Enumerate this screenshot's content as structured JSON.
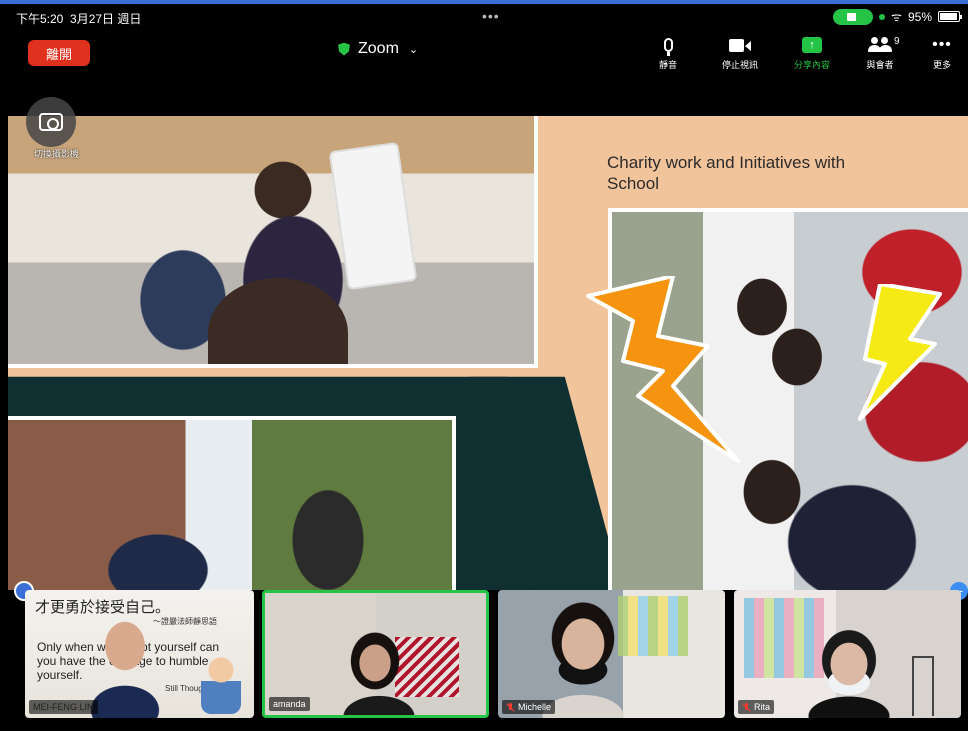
{
  "status_bar": {
    "time": "下午5:20",
    "date": "3月27日 週日",
    "battery": "95%",
    "battery_level": 0.95
  },
  "toolbar": {
    "leave_label": "離開",
    "meeting_title": "Zoom",
    "mute_label": "靜音",
    "stop_video_label": "停止視訊",
    "share_label": "分享內容",
    "participants_label": "與會者",
    "participants_count": "9",
    "more_label": "更多"
  },
  "camera_flip": {
    "label": "切換攝影機"
  },
  "shared_slide": {
    "title": "Charity work and Initiatives with School"
  },
  "participants": [
    {
      "name": "MEI-FENG LIN",
      "muted": false,
      "quote_zh": "才更勇於接受自己。",
      "quote_zh_attr": "～證嚴法師靜思語",
      "quote_en": "Only when we accept yourself can you have the courage to humble yourself.",
      "quote_en_attr": "Still Thoughts"
    },
    {
      "name": "amanda",
      "muted": false
    },
    {
      "name": "Michelle",
      "muted": true
    },
    {
      "name": "Rita",
      "muted": true
    }
  ],
  "colors": {
    "leave": "#e0301e",
    "active_speaker": "#25c346",
    "share_green": "#25c346",
    "slide_peach": "#f2c49b",
    "slide_teal": "#0f2f30",
    "bolt_orange": "#f7940f",
    "bolt_yellow": "#f5ea14"
  }
}
